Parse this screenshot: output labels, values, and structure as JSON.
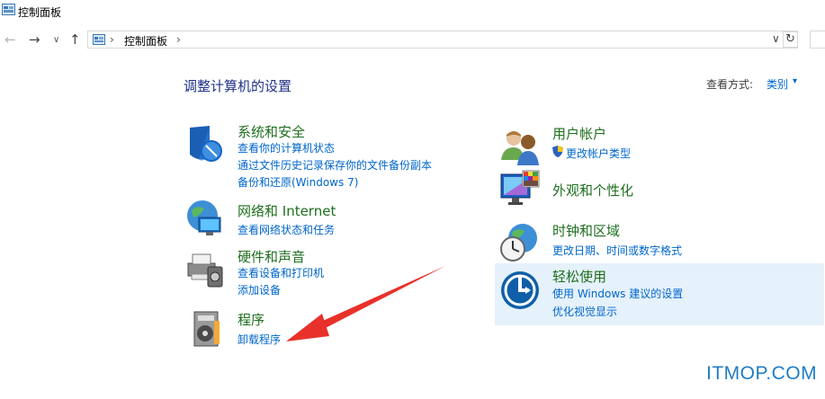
{
  "window": {
    "title": "控制面板"
  },
  "nav": {
    "back_icon": "arrow-left-icon",
    "forward_icon": "arrow-right-icon",
    "recent_icon": "chevron-down-icon",
    "up_icon": "arrow-up-icon",
    "refresh_icon": "refresh-icon"
  },
  "address": {
    "separator": "›",
    "crumb": "控制面板",
    "dropdown_glyph": "∨"
  },
  "page": {
    "heading": "调整计算机的设置"
  },
  "view": {
    "label": "查看方式:",
    "value": "类别",
    "arrow": "▾"
  },
  "left_categories": [
    {
      "title": "系统和安全",
      "links": [
        "查看你的计算机状态",
        "通过文件历史记录保存你的文件备份副本",
        "备份和还原(Windows 7)"
      ]
    },
    {
      "title": "网络和 Internet",
      "links": [
        "查看网络状态和任务"
      ]
    },
    {
      "title": "硬件和声音",
      "links": [
        "查看设备和打印机",
        "添加设备"
      ]
    },
    {
      "title": "程序",
      "links": [
        "卸载程序"
      ]
    }
  ],
  "right_categories": [
    {
      "title": "用户帐户",
      "links": [
        "更改帐户类型"
      ]
    },
    {
      "title": "外观和个性化",
      "links": []
    },
    {
      "title": "时钟和区域",
      "links": [
        "更改日期、时间或数字格式"
      ]
    },
    {
      "title": "轻松使用",
      "links": [
        "使用 Windows 建议的设置",
        "优化视觉显示"
      ]
    }
  ],
  "watermark": "ITMOP.COM",
  "colors": {
    "heading": "#1e3287",
    "category_title": "#1e6e1e",
    "link": "#0066cc",
    "highlight": "#e5f1fb",
    "arrow": "#e8312a",
    "watermark": "#1f7cc4"
  }
}
